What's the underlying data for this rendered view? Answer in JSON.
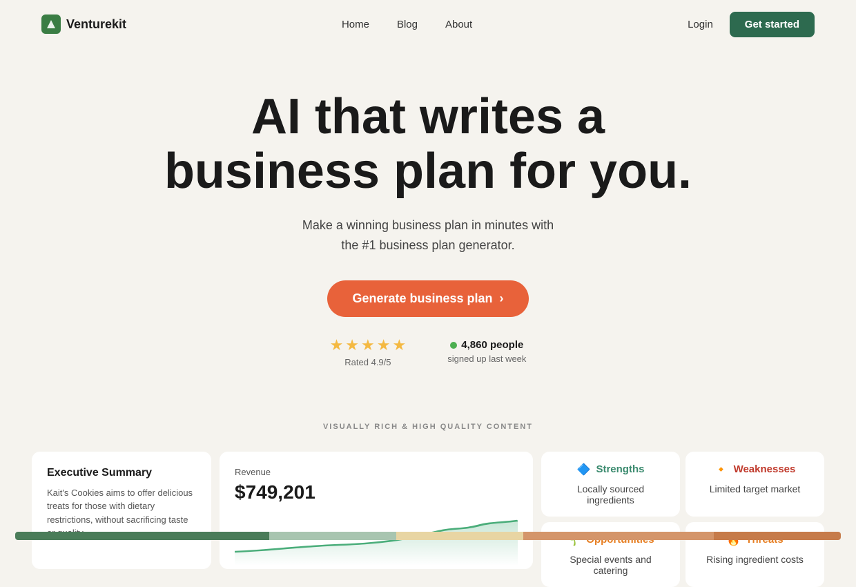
{
  "brand": {
    "name": "Venturekit",
    "logo_icon": "V"
  },
  "nav": {
    "links": [
      "Home",
      "Blog",
      "About"
    ],
    "login_label": "Login",
    "get_started_label": "Get started"
  },
  "hero": {
    "title_line1": "AI that writes a",
    "title_line2": "business plan for you.",
    "subtitle_line1": "Make a winning business plan in minutes with",
    "subtitle_line2": "the #1 business plan generator.",
    "cta_label": "Generate business plan"
  },
  "social_proof": {
    "stars": 4.9,
    "rated_text": "Rated 4.9/5",
    "people_count": "4,860 people",
    "signed_up_text": "signed up last week"
  },
  "section_label": "VISUALLY RICH & HIGH QUALITY CONTENT",
  "exec_summary": {
    "title": "Executive Summary",
    "text": "Kait's Cookies aims to offer delicious treats for those with dietary restrictions, without sacrificing taste or quality."
  },
  "revenue": {
    "label": "Revenue",
    "amount": "$749,201"
  },
  "swot": {
    "strengths": {
      "title": "Strengths",
      "text": "Locally sourced ingredients",
      "icon": "🔷"
    },
    "weaknesses": {
      "title": "Weaknesses",
      "text": "Limited target market",
      "icon": "🔸"
    },
    "opportunities": {
      "title": "Opportunities",
      "text": "Special events and catering",
      "icon": "🌱"
    },
    "threats": {
      "title": "Threats",
      "text": "Rising ingredient costs",
      "icon": "🔥"
    }
  }
}
